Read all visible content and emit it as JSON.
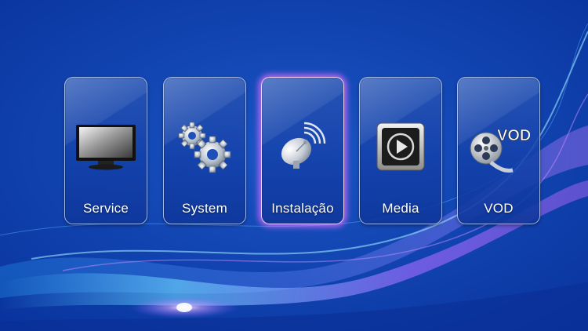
{
  "menu": {
    "items": [
      {
        "id": "service",
        "label": "Service",
        "icon": "tv-icon",
        "selected": false
      },
      {
        "id": "system",
        "label": "System",
        "icon": "gears-icon",
        "selected": false
      },
      {
        "id": "instalacao",
        "label": "Instalação",
        "icon": "satellite-dish-icon",
        "selected": true
      },
      {
        "id": "media",
        "label": "Media",
        "icon": "play-icon",
        "selected": false
      },
      {
        "id": "vod",
        "label": "VOD",
        "icon": "film-reel-vod-icon",
        "selected": false
      }
    ],
    "vod_icon_text": "VOD"
  },
  "colors": {
    "background": "#0b3da8",
    "selected_glow": "#dc6eff",
    "label_text": "#ffffff"
  }
}
